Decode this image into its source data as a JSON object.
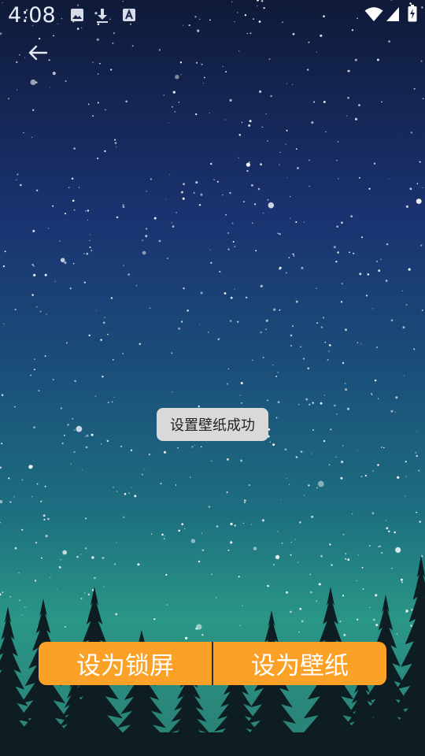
{
  "status_bar": {
    "time": "4:08",
    "icons_left": [
      "image-icon",
      "download-icon",
      "text-a-icon"
    ],
    "icons_right": [
      "wifi-icon",
      "cellular-signal-icon",
      "battery-icon"
    ]
  },
  "nav": {
    "back_icon": "arrow-left-icon"
  },
  "toast": {
    "message": "设置壁纸成功"
  },
  "actions": {
    "lock_screen_label": "设为锁屏",
    "wallpaper_label": "设为壁纸"
  },
  "colors": {
    "accent": "#fca127",
    "toast_bg": "#d9d9d9",
    "sky_top": "#0c1c3e",
    "sky_mid": "#1a5478",
    "sky_bottom": "#2b8f86"
  }
}
